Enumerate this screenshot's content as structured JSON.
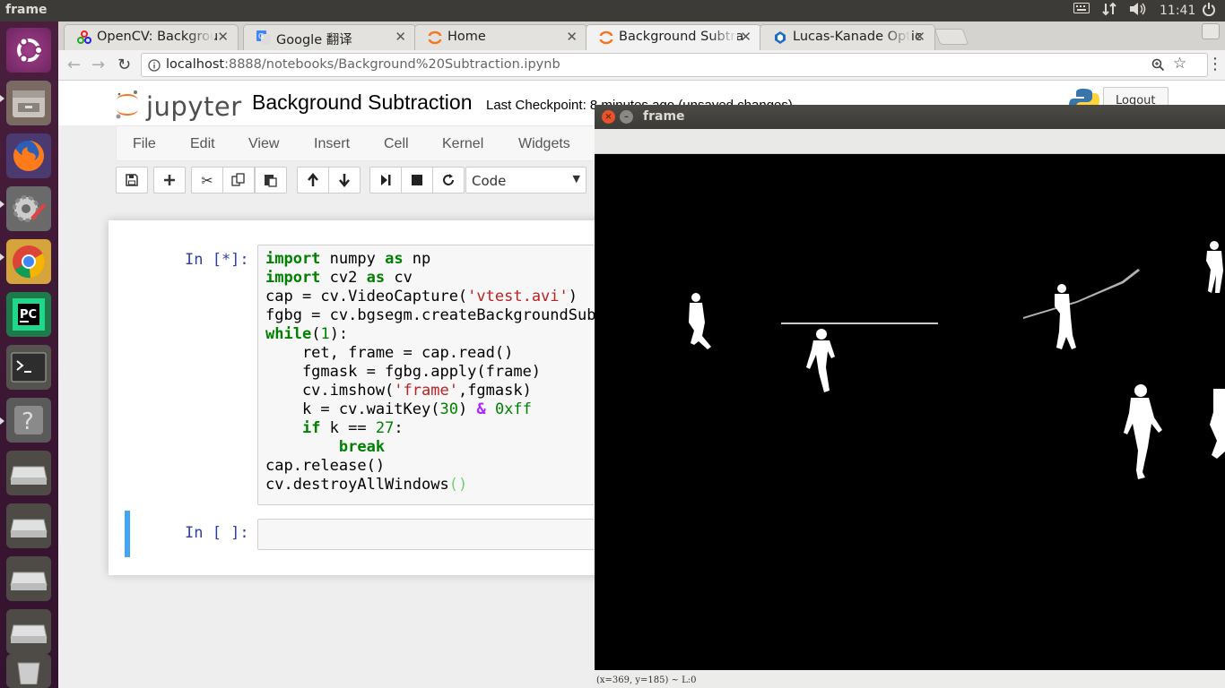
{
  "top_panel": {
    "title": "frame",
    "time": "11:41",
    "icons": [
      "keyboard-icon",
      "network-icon",
      "volume-icon",
      "power-icon"
    ]
  },
  "launcher": {
    "items": [
      "ubuntu-dash-icon",
      "files-icon",
      "firefox-icon",
      "system-settings-icon",
      "chrome-icon",
      "pycharm-icon",
      "terminal-icon",
      "help-icon",
      "drive-icon",
      "drive-icon",
      "drive-icon",
      "drive-icon",
      "trash-icon"
    ]
  },
  "browser": {
    "tabs": [
      {
        "label": "OpenCV: Backgrou"
      },
      {
        "label": "Google 翻译"
      },
      {
        "label": "Home"
      },
      {
        "label": "Background Subtra"
      },
      {
        "label": "Lucas-Kanade Optic"
      }
    ],
    "url_host": "localhost",
    "url_rest": ":8888/notebooks/Background%20Subtraction.ipynb"
  },
  "jupyter": {
    "logo_text": "jupyter",
    "notebook_name": "Background Subtraction",
    "checkpoint": "Last Checkpoint: 8 minutes ago (unsaved changes)",
    "logout": "Logout",
    "menus": [
      "File",
      "Edit",
      "View",
      "Insert",
      "Cell",
      "Kernel",
      "Widgets"
    ],
    "cell_type": "Code",
    "cells": [
      {
        "prompt": "In [*]:"
      },
      {
        "prompt": "In [ ]:"
      }
    ]
  },
  "cv_window": {
    "title": "frame",
    "status": "(x=369, y=185) ~ L:0"
  }
}
